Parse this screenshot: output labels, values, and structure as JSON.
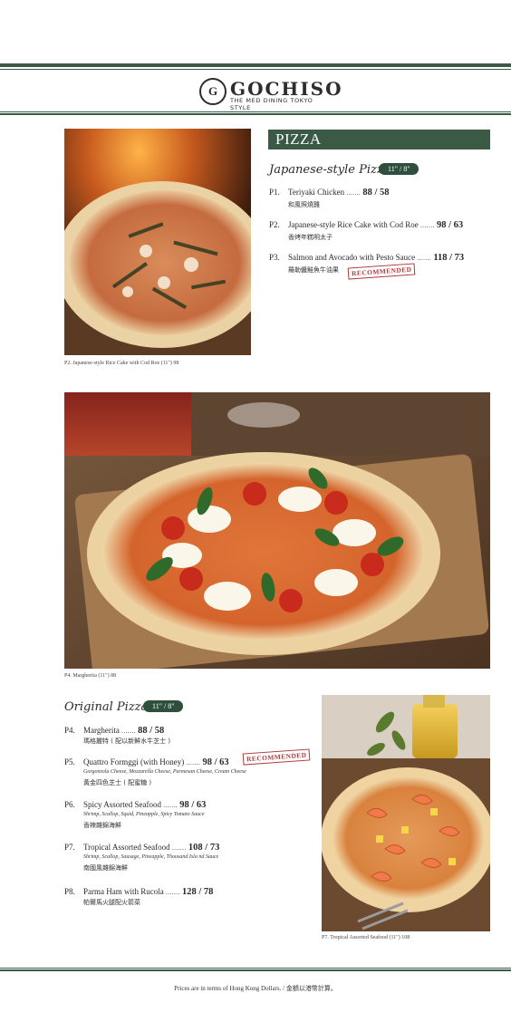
{
  "brand": {
    "logo_mark": "G",
    "name": "GOCHISO",
    "tagline": "THE MED DINING TOKYO STYLE"
  },
  "section": {
    "title": "PIZZA"
  },
  "japanese": {
    "title": "Japanese-style Pizza",
    "sizes": "11\" / 8\"",
    "items": [
      {
        "code": "P1.",
        "name": "Teriyaki Chicken",
        "dots": ".......",
        "price": "88 / 58",
        "cn": "和風照燒雞"
      },
      {
        "code": "P2.",
        "name": "Japanese-style Rice Cake with Cod Roe",
        "dots": ".......",
        "price": "98 / 63",
        "cn": "香烤年糕明太子"
      },
      {
        "code": "P3.",
        "name": "Salmon and Avocado with Pesto Sauce",
        "dots": ".......",
        "price": "118 / 73",
        "cn": "羅勒醬鮭魚牛油果",
        "stamp": "RECOMMENDED"
      }
    ]
  },
  "original": {
    "title": "Original Pizza",
    "sizes": "11\" / 8\"",
    "items": [
      {
        "code": "P4.",
        "name": "Margherita",
        "dots": ".......",
        "price": "88 / 58",
        "cn": "瑪格麗特 ( 配以新鮮水牛芝士 )"
      },
      {
        "code": "P5.",
        "name": "Quattro Formggi (with Honey)",
        "dots": ".......",
        "price": "98 / 63",
        "desc": "Gorgonzola Cheese, Mozzarella Cheese, Parmesan Cheese, Cream Cheese",
        "cn": "黃金四色芝士 ( 配蜜糖 )",
        "stamp": "RECOMMENDED"
      },
      {
        "code": "P6.",
        "name": "Spicy Assorted Seafood",
        "dots": ".......",
        "price": "98 / 63",
        "desc": "Shrimp, Scallop, Squid, Pineapple, Spicy Tomato Sauce",
        "cn": "香辣雜錦海鮮"
      },
      {
        "code": "P7.",
        "name": "Tropical Assorted Seafood",
        "dots": ".......",
        "price": "108 / 73",
        "desc": "Shrimp, Scallop, Sausage, Pineapple, Thousand Isla nd Sauce",
        "cn": "南國風雜錦海鮮"
      },
      {
        "code": "P8.",
        "name": "Parma Ham with Rucola",
        "dots": ".......",
        "price": "128 / 78",
        "cn": "帕爾馬火腿配火箭菜"
      }
    ]
  },
  "captions": {
    "photo1": "P2. Japanese-style Rice Cake with Cod Roe (11\")  98",
    "photo2": "P4. Margherita (11\")  88",
    "photo3": "P7. Tropical Assorted Seafood (11\")  108"
  },
  "footer": {
    "note": "Prices are in terms of Hong Kong Dollars. / 金額以港幣計算。"
  },
  "colors": {
    "accent_green": "#3a5a45",
    "stamp_red": "#b03a3a"
  }
}
